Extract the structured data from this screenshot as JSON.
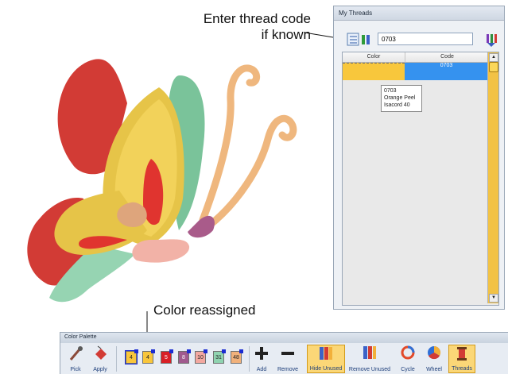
{
  "callouts": {
    "thread_code": "Enter thread code\nif known",
    "color_reassigned": "Color reassigned"
  },
  "my_threads": {
    "title": "My Threads",
    "code_input_value": "0703",
    "columns": [
      "Color",
      "Code"
    ],
    "selected_row": {
      "code": "0703",
      "swatch_color": "#f8c73c"
    },
    "tooltip": [
      "0703",
      "Orange Peel",
      "Isacord 40"
    ]
  },
  "color_palette": {
    "title": "Color Palette",
    "tools": {
      "pick": "Pick",
      "apply": "Apply",
      "add": "Add",
      "remove": "Remove",
      "hide_unused": "Hide Unused",
      "remove_unused": "Remove Unused",
      "cycle": "Cycle",
      "wheel": "Wheel",
      "threads": "Threads"
    },
    "chips": [
      {
        "label": "4",
        "color": "#f9c63b"
      },
      {
        "label": "4",
        "color": "#f9c63b"
      },
      {
        "label": "5",
        "color": "#d81f26"
      },
      {
        "label": "8",
        "color": "#a05a8e"
      },
      {
        "label": "10",
        "color": "#f3a8a0"
      },
      {
        "label": "31",
        "color": "#8fd3b0"
      },
      {
        "label": "48",
        "color": "#f1b17b"
      }
    ]
  }
}
